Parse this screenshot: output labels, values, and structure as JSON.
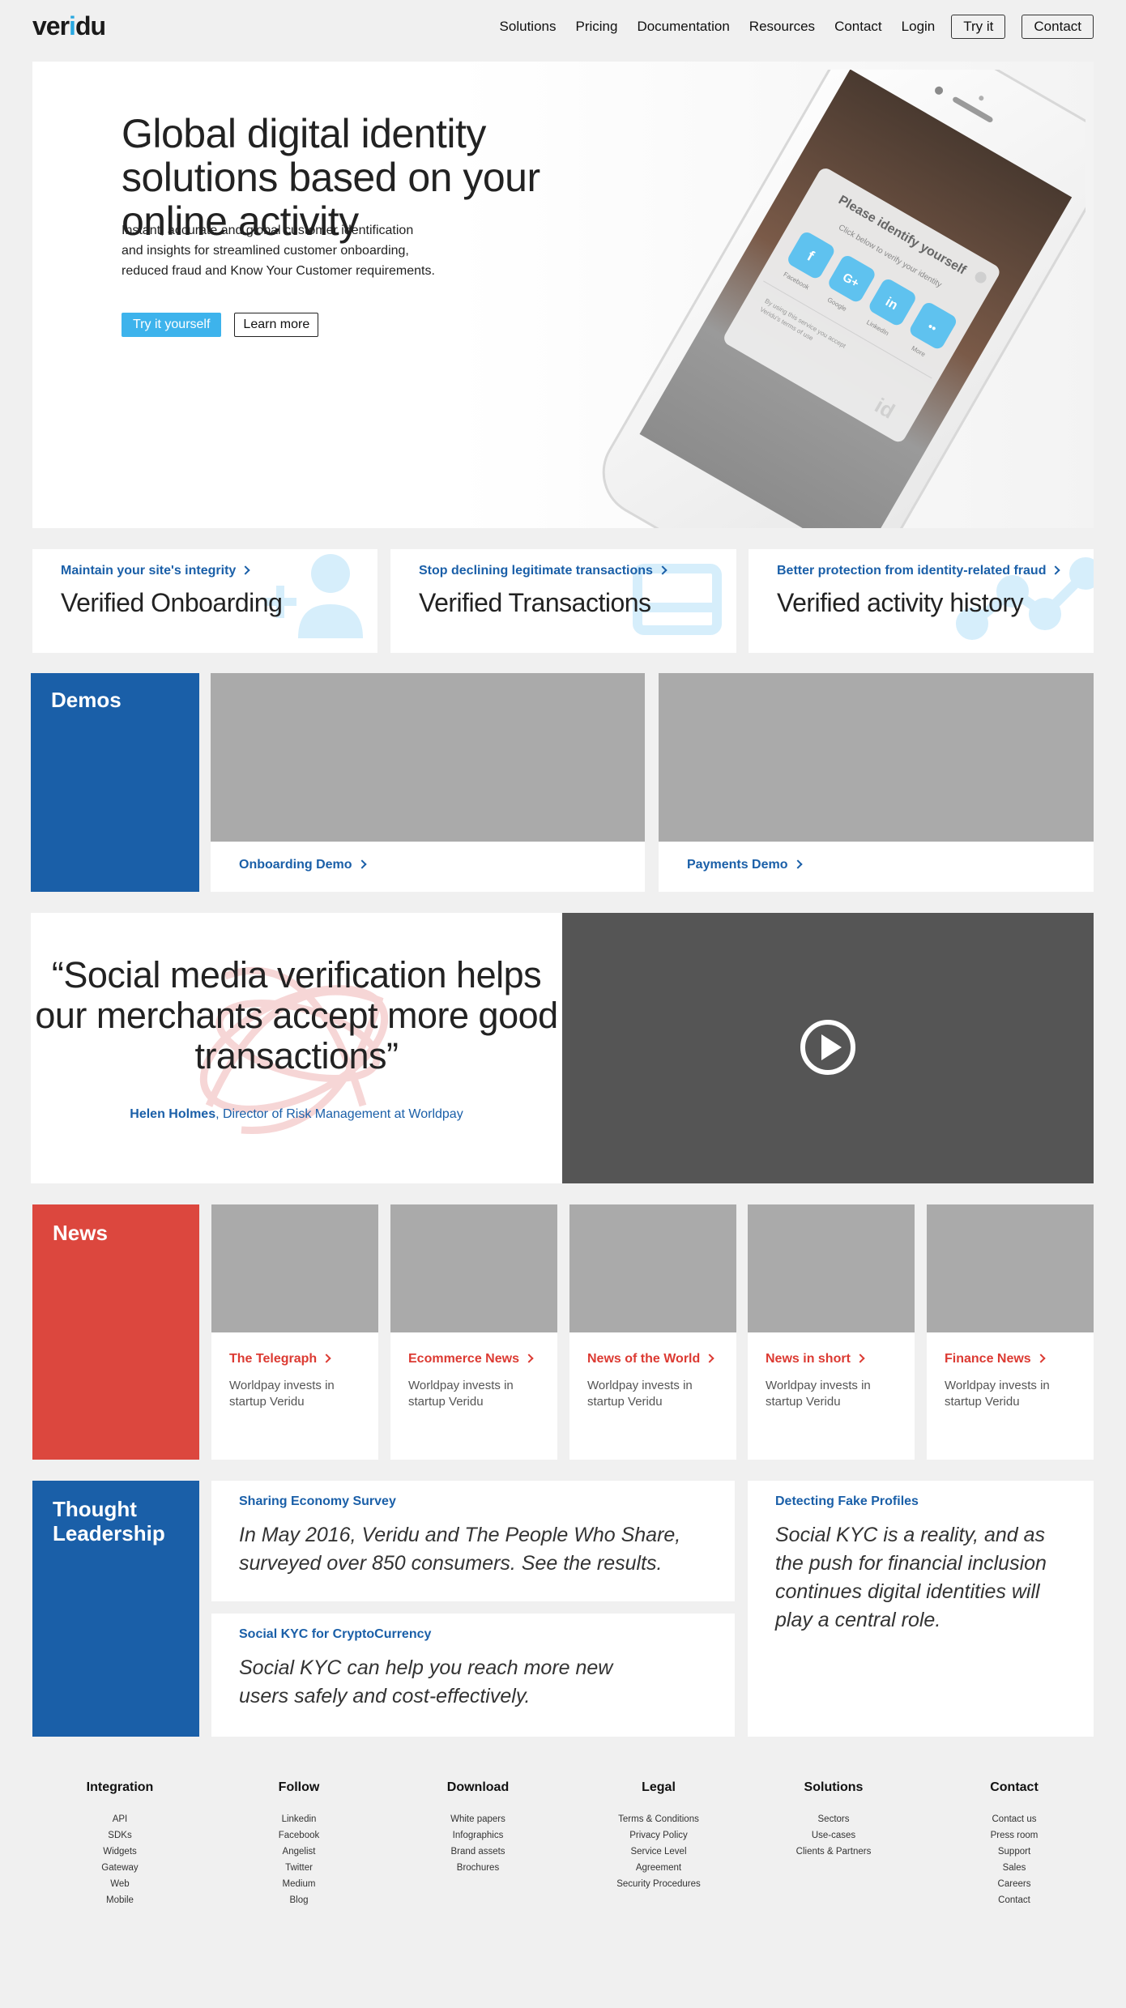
{
  "header": {
    "logo_pre": "ver",
    "logo_i": "i",
    "logo_post": "du",
    "nav": [
      "Solutions",
      "Pricing",
      "Documentation",
      "Resources",
      "Contact",
      "Login"
    ],
    "try_it": "Try it",
    "contact": "Contact"
  },
  "hero": {
    "title": "Global digital identity solutions based on your online activity",
    "description": "Instant, accurate and global customer identification and insights for streamlined customer onboarding, reduced fraud and Know Your Customer requirements.",
    "try_button": "Try it yourself",
    "learn_button": "Learn more",
    "phone": {
      "prompt_title": "Please identify yourself",
      "prompt_sub": "Click below to verify your identity",
      "providers": [
        "Facebook",
        "Google",
        "LinkedIn",
        "More"
      ],
      "terms_line1": "By using this service you accept",
      "terms_line2": "Veridu's terms of use",
      "badge": "id"
    }
  },
  "features": [
    {
      "link": "Maintain your site's integrity",
      "title": "Verified Onboarding",
      "icon": "add-user-icon"
    },
    {
      "link": "Stop declining legitimate transactions",
      "title": "Verified Transactions",
      "icon": "card-icon"
    },
    {
      "link": "Better protection from identity-related fraud",
      "title": "Verified activity history",
      "icon": "activity-graph-icon"
    }
  ],
  "demos": {
    "label": "Demos",
    "items": [
      "Onboarding Demo",
      "Payments Demo"
    ]
  },
  "testimonial": {
    "quote": "“Social media verification helps our merchants accept more good transactions”",
    "author_name": "Helen Holmes",
    "author_role": ", Director of Risk Management at Worldpay"
  },
  "news": {
    "label": "News",
    "items": [
      {
        "source": "The Telegraph",
        "text": "Worldpay invests in startup Veridu"
      },
      {
        "source": "Ecommerce News",
        "text": "Worldpay invests in startup Veridu"
      },
      {
        "source": "News of the World",
        "text": "Worldpay invests in startup Veridu"
      },
      {
        "source": "News in short",
        "text": "Worldpay invests in startup Veridu"
      },
      {
        "source": "Finance News",
        "text": "Worldpay invests in startup Veridu"
      }
    ]
  },
  "thought_leadership": {
    "label_line1": "Thought",
    "label_line2": "Leadership",
    "items": [
      {
        "title": "Sharing Economy Survey",
        "body": "In May 2016, Veridu and The People Who Share, surveyed over 850 consumers. See the results."
      },
      {
        "title": "Social KYC for CryptoCurrency",
        "body": "Social KYC can help you reach more new users safely and cost-effectively."
      },
      {
        "title": "Detecting Fake Profiles",
        "body": "Social KYC is a reality, and as the push for financial inclusion continues digital identities will play a central role."
      }
    ]
  },
  "footer": [
    {
      "heading": "Integration",
      "links": [
        "API",
        "SDKs",
        "Widgets",
        "Gateway",
        "Web",
        "Mobile"
      ]
    },
    {
      "heading": "Follow",
      "links": [
        "Linkedin",
        "Facebook",
        "Angelist",
        "Twitter",
        "Medium",
        "Blog"
      ]
    },
    {
      "heading": "Download",
      "links": [
        "White papers",
        "Infographics",
        "Brand assets",
        "Brochures"
      ]
    },
    {
      "heading": "Legal",
      "links": [
        "Terms & Conditions",
        "Privacy Policy",
        "Service Level",
        "Agreement",
        "Security Procedures"
      ]
    },
    {
      "heading": "Solutions",
      "links": [
        "Sectors",
        "Use-cases",
        "Clients & Partners"
      ]
    },
    {
      "heading": "Contact",
      "links": [
        "Contact us",
        "Press room",
        "Support",
        "Sales",
        "Careers",
        "Contact"
      ]
    }
  ],
  "colors": {
    "brand_blue": "#1a5fa8",
    "accent_cyan": "#3db3ec",
    "news_red": "#dc3a32"
  }
}
